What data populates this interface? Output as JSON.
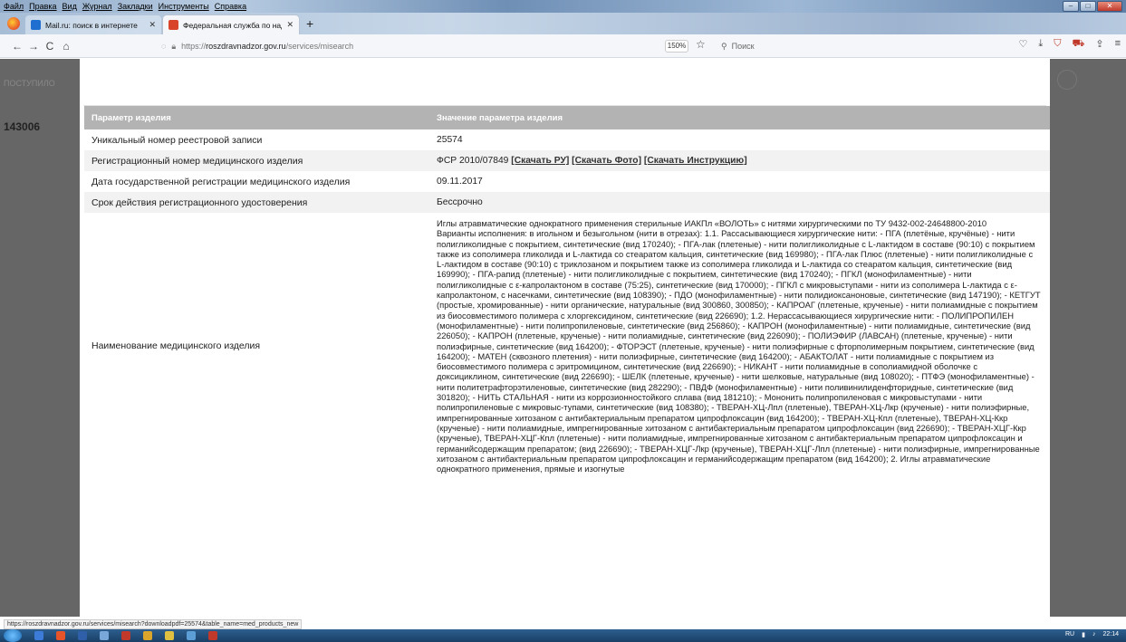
{
  "menu": [
    "Файл",
    "Правка",
    "Вид",
    "Журнал",
    "Закладки",
    "Инструменты",
    "Справка"
  ],
  "window_controls": {
    "minimize": "–",
    "maximize": "□",
    "close": "✕"
  },
  "tabs": [
    {
      "title": "Mail.ru: поиск в интернете",
      "close": "✕"
    },
    {
      "title": "Федеральная служба по надзо",
      "close": "✕"
    }
  ],
  "new_tab": "+",
  "nav": {
    "back": "←",
    "forward": "→",
    "reload": "C",
    "home": "⌂"
  },
  "url": {
    "prefix": "https://",
    "host": "roszdravnadzor.gov.ru",
    "path": "/services/misearch"
  },
  "zoom": "150%",
  "search_placeholder": "Поиск",
  "left_strip": {
    "t1": "ПОСТУПИЛО",
    "t2": "143006"
  },
  "table": {
    "headers": [
      "Параметр изделия",
      "Значение параметра изделия"
    ],
    "rows": [
      {
        "param": "Уникальный номер реестровой записи",
        "value": "25574"
      },
      {
        "param": "Регистрационный номер медицинского изделия",
        "value": "ФСР 2010/07849",
        "links": [
          "[Скачать РУ]",
          "[Скачать Фото]",
          "[Скачать Инструкцию]"
        ]
      },
      {
        "param": "Дата государственной регистрации медицинского изделия",
        "value": "09.11.2017"
      },
      {
        "param": "Срок действия регистрационного удостоверения",
        "value": "Бессрочно"
      },
      {
        "param": "Наименование медицинского изделия",
        "value": "Иглы атравматические однократного применения стерильные ИАКПл «ВОЛОТЬ» с нитями хирургическими по ТУ 9432-002-24648800-2010\nВарианты исполнения: в игольном и безыгольном (нити в отрезах): 1.1. Рассасывающиеся хирургические нити: - ПГА (плетёные, кручёные) - нити полигликолидные с покрытием, синтетические (вид 170240); - ПГА-лак (плетеные) - нити полигликолидные с L-лактидом в составе (90:10) с покрытием также из сополимера гликолида и L-лактида со стеаратом кальция, синтетические (вид 169980); - ПГА-лак Плюс (плетеные) - нити полигликолидные с L-лактидом в составе (90:10) с триклозаном и покрытием также из сополимера гликолида и L-лактида со стеаратом кальция, синтетические (вид 169990); - ПГА-рапид (плетеные) - нити полигликолидные с покрытием, синтетические (вид 170240); - ПГКЛ (монофиламентные) - нити полигликолидные с ε-капролактоном в составе (75:25), синтетические (вид 170000); - ПГКЛ с микровыступами - нити из сополимера L-лактида с ε-капролактоном, с насечками, синтетические (вид 108390); - ПДО (монофиламентные) - нити полидиоксаноновые, синтетические (вид 147190); - КЕТГУТ (простые, хромированные) - нити органические, натуральные (вид 300860, 300850); - КАПРОАГ (плетеные, крученые) - нити полиамидные с покрытием из биосовместимого полимера с хлоргексидином, синтетические (вид 226690); 1.2. Нерассасывающиеся хирургические нити: - ПОЛИПРОПИЛЕН (монофиламентные) - нити полипропиленовые, синтетические (вид 256860); - КАПРОН (монофиламентные) - нити полиамидные, синтетические (вид 226050); - КАПРОН (плетеные, крученые) - нити полиамидные, синтетические (вид 226090); - ПОЛИЭФИР (ЛАВСАН) (плетеные, крученые) - нити полиэфирные, синтетические (вид 164200); - ФТОРЭСТ (плетеные, крученые) - нити полиэфирные с фторполимерным покрытием, синтетические (вид 164200); - МАТЕН (сквозного плетения) - нити полиэфирные, синтетические (вид 164200); - АБАКТОЛАТ - нити полиамидные с покрытием из биосовместимого полимера с эритромицином, синтетические (вид 226690); - НИКАНТ - нити полиамидные в сополиамидной оболочке с доксициклином, синтетические (вид 226690); - ШЕЛК (плетеные, крученые) - нити шелковые, натуральные (вид 108020); - ПТФЭ (монофиламентные) - нити политетрафторэтиленовые, синтетические (вид 282290); - ПВДФ (монофиламентные) - нити поливинилиденфторидные, синтетические (вид 301820); - НИТЬ СТАЛЬНАЯ - нити из коррозионностойкого сплава (вид 181210); - Мононить полипропиленовая с микровыступами - нити полипропиленовые с микровыс-тупами, синтетические (вид 108380); - ТВЕРАН-ХЦ-Лпл (плетеные), ТВЕРАН-ХЦ-Лкр (крученые) - нити полиэфирные, импрегнированные хитозаном с антибактериальным препаратом ципрофлоксацин (вид 164200); - ТВЕРАН-ХЦ-Кпл (плетеные), ТВЕРАН-ХЦ-Ккр (крученые) - нити полиамидные, импрегнированные хитозаном с антибактериальным препаратом ципрофлоксацин (вид 226690); - ТВЕРАН-ХЦГ-Ккр (крученые), ТВЕРАН-ХЦГ-Кпл (плетеные) - нити полиамидные, импрегнированные хитозаном с антибактериальным препаратом ципрофлоксацин и германийсодержащим препаратом; (вид 226690); - ТВЕРАН-ХЦГ-Лкр (крученые), ТВЕРАН-ХЦГ-Лпл (плетеные) - нити полиэфирные, импрегнированные хитозаном с антибактериальным препаратом ципрофлоксацин и германийсодержащим препаратом (вид 164200); 2. Иглы атравматические однократного применения, прямые и изогнутые"
      }
    ]
  },
  "status_url": "https://roszdravnadzor.gov.ru/services/misearch?downloadpdf=25574&table_name=med_products_new",
  "tray": {
    "lang": "RU",
    "time": "22:14"
  },
  "colors": {
    "header_bg": "#b3b3b3",
    "stripe": "#f2f2f2",
    "side_dark": "#666666"
  }
}
